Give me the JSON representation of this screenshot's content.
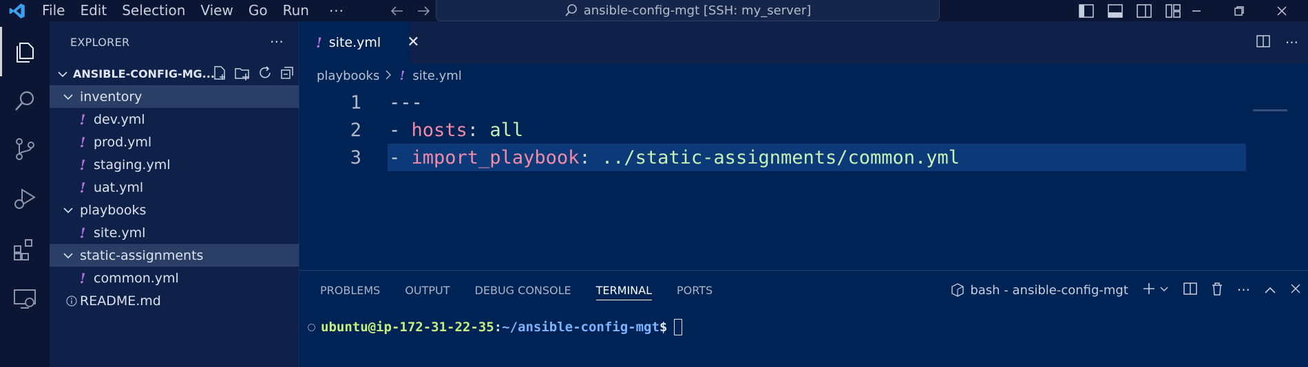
{
  "titlebar": {
    "menu": [
      "File",
      "Edit",
      "Selection",
      "View",
      "Go",
      "Run"
    ],
    "more": "···",
    "search_text": "ansible-config-mgt [SSH: my_server]"
  },
  "sidebar": {
    "header": "EXPLORER",
    "more": "···",
    "section_title": "ANSIBLE-CONFIG-MG...",
    "tree": {
      "inventory": "inventory",
      "dev": "dev.yml",
      "prod": "prod.yml",
      "staging": "staging.yml",
      "uat": "uat.yml",
      "playbooks": "playbooks",
      "site": "site.yml",
      "static": "static-assignments",
      "common": "common.yml",
      "readme": "README.md"
    }
  },
  "editor": {
    "tab_label": "site.yml",
    "breadcrumb_folder": "playbooks",
    "breadcrumb_file": "site.yml",
    "more": "···",
    "lines": [
      {
        "num": "1",
        "dash": "---"
      },
      {
        "num": "2",
        "dash": "- ",
        "key": "hosts",
        "colon": ": ",
        "value": "all"
      },
      {
        "num": "3",
        "dash": "- ",
        "key": "import_playbook",
        "colon": ": ",
        "value": "../static-assignments/common.yml"
      }
    ]
  },
  "panel": {
    "tabs": [
      "PROBLEMS",
      "OUTPUT",
      "DEBUG CONSOLE",
      "TERMINAL",
      "PORTS"
    ],
    "terminal_name": "bash - ansible-config-mgt",
    "prompt_user": "ubuntu@ip-172-31-22-35",
    "prompt_colon": ":",
    "prompt_path": "~/ansible-config-mgt",
    "prompt_dollar": "$"
  },
  "colors": {
    "accent": "#b476e0",
    "editor_bg": "#002355",
    "key": "#f28ba7",
    "string": "#c7f0b6"
  }
}
